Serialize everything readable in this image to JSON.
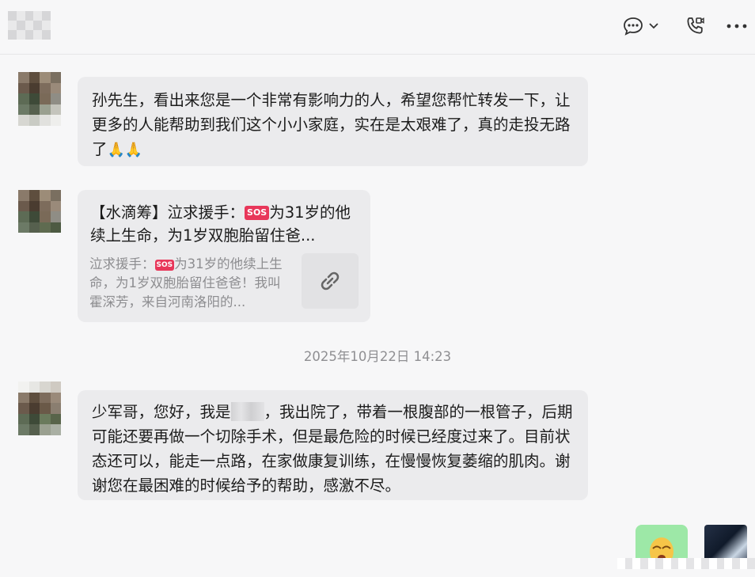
{
  "header": {
    "icons": [
      "chat-bubble-icon",
      "chevron-down-icon",
      "phone-video-icon",
      "more-icon"
    ]
  },
  "messages": [
    {
      "text": "孙先生，看出来您是一个非常有影响力的人，希望您帮忙转发一下，让更多的人能帮助到我们这个小小家庭，实在是太艰难了，真的走投无路了",
      "emoji": "🙏🙏"
    }
  ],
  "link_card": {
    "title_prefix": "【水滴筹】泣求援手：",
    "title_rest": "为31岁的他续上生命，为1岁双胞胎留住爸...",
    "desc_prefix": "泣求援手：",
    "desc_rest": "为31岁的他续上生命，为1岁双胞胎留住爸爸！我叫霍深芳，来自河南洛阳的...",
    "badge": "SOS"
  },
  "timestamp": "2025年10月22日 14:23",
  "message2": {
    "before": "少军哥，您好，我是",
    "after": "，我出院了，带着一根腹部的一根管子，后期可能还要再做一个切除手术，但是最危险的时候已经度过来了。目前状态还可以，能走一点路，在家做康复训练，在慢慢恢复萎缩的肌肉。谢谢您在最困难的时候给予的帮助，感激不尽。"
  },
  "colors": {
    "bubble": "#ebebed",
    "background": "#f7f7f8",
    "sos": "#e8375a",
    "sticker": "#9de8a7"
  }
}
